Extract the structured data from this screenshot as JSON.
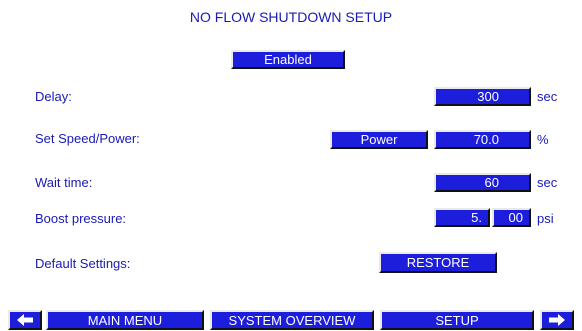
{
  "title": "NO FLOW SHUTDOWN SETUP",
  "status_button": "Enabled",
  "fields": {
    "delay": {
      "label": "Delay:",
      "value": "300",
      "unit": "sec"
    },
    "set_speed_power": {
      "label": "Set Speed/Power:",
      "mode": "Power",
      "value": "70.0",
      "unit": "%"
    },
    "wait_time": {
      "label": "Wait time:",
      "value": "60",
      "unit": "sec"
    },
    "boost_pressure": {
      "label": "Boost pressure:",
      "value_integer": "5.",
      "value_fraction": "00",
      "unit": "psi"
    },
    "default_settings": {
      "label": "Default Settings:",
      "button": "RESTORE"
    }
  },
  "nav": {
    "back_icon": "arrow-left-icon",
    "forward_icon": "arrow-right-icon",
    "main_menu": "MAIN MENU",
    "system_overview": "SYSTEM OVERVIEW",
    "setup": "SETUP"
  },
  "colors": {
    "accent": "#1d1ddc",
    "text": "#1a1ab4",
    "background": "#ffffff"
  }
}
